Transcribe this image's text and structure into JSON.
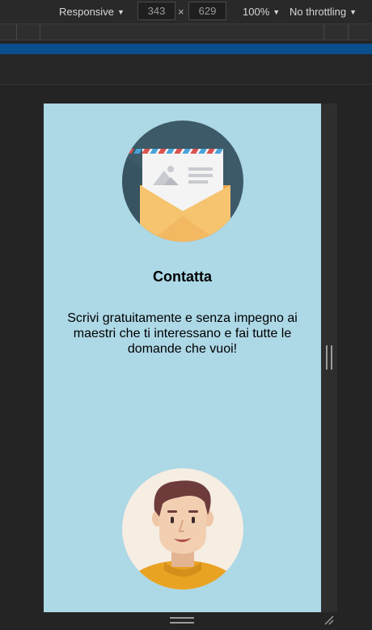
{
  "devtools": {
    "device_mode": "Responsive",
    "width_value": "343",
    "height_value": "629",
    "zoom": "100%",
    "throttling": "No throttling",
    "dropdown_icon": "triangle-down-icon",
    "times_symbol": "×"
  },
  "page": {
    "title": "Contatta",
    "description": "Scrivi gratuitamente e senza impegno ai maestri che ti interessano e fai tutte le domande che vuoi!",
    "background_color": "#add8e6",
    "top_illustration": "envelope-letter-icon",
    "bottom_illustration": "teacher-avatar-icon"
  }
}
